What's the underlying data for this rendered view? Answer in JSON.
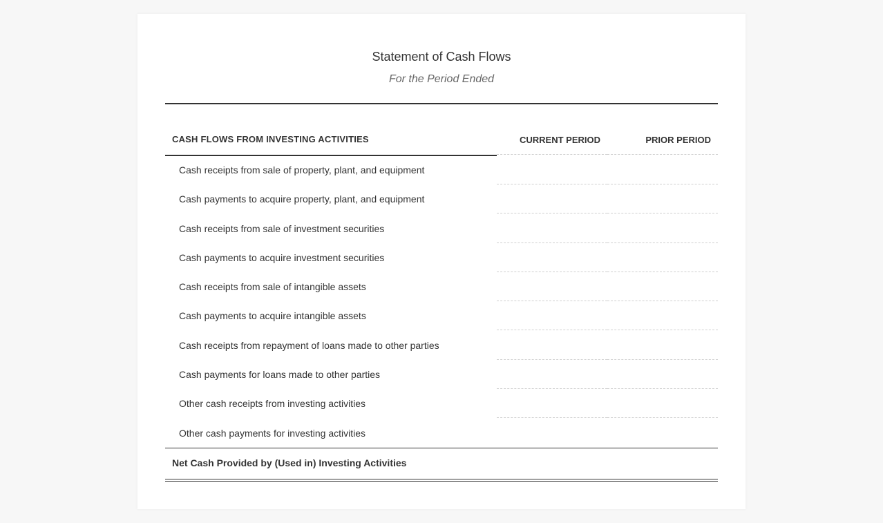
{
  "document": {
    "title": "Statement of Cash Flows",
    "subtitle": "For the Period Ended"
  },
  "table": {
    "section_heading": "CASH FLOWS FROM INVESTING ACTIVITIES",
    "columns": [
      "CURRENT PERIOD",
      "PRIOR PERIOD"
    ],
    "rows": [
      {
        "label": "Cash receipts from sale of property, plant, and equipment",
        "current": "",
        "prior": ""
      },
      {
        "label": "Cash payments to acquire property, plant, and equipment",
        "current": "",
        "prior": ""
      },
      {
        "label": "Cash receipts from sale of investment securities",
        "current": "",
        "prior": ""
      },
      {
        "label": "Cash payments to acquire investment securities",
        "current": "",
        "prior": ""
      },
      {
        "label": "Cash receipts from sale of intangible assets",
        "current": "",
        "prior": ""
      },
      {
        "label": "Cash payments to acquire intangible assets",
        "current": "",
        "prior": ""
      },
      {
        "label": "Cash receipts from repayment of loans made to other parties",
        "current": "",
        "prior": ""
      },
      {
        "label": "Cash payments for loans made to other parties",
        "current": "",
        "prior": ""
      },
      {
        "label": "Other cash receipts from investing activities",
        "current": "",
        "prior": ""
      },
      {
        "label": "Other cash payments for investing activities",
        "current": "",
        "prior": ""
      }
    ],
    "total": {
      "label": "Net Cash Provided by (Used in) Investing Activities",
      "current": "",
      "prior": ""
    }
  }
}
